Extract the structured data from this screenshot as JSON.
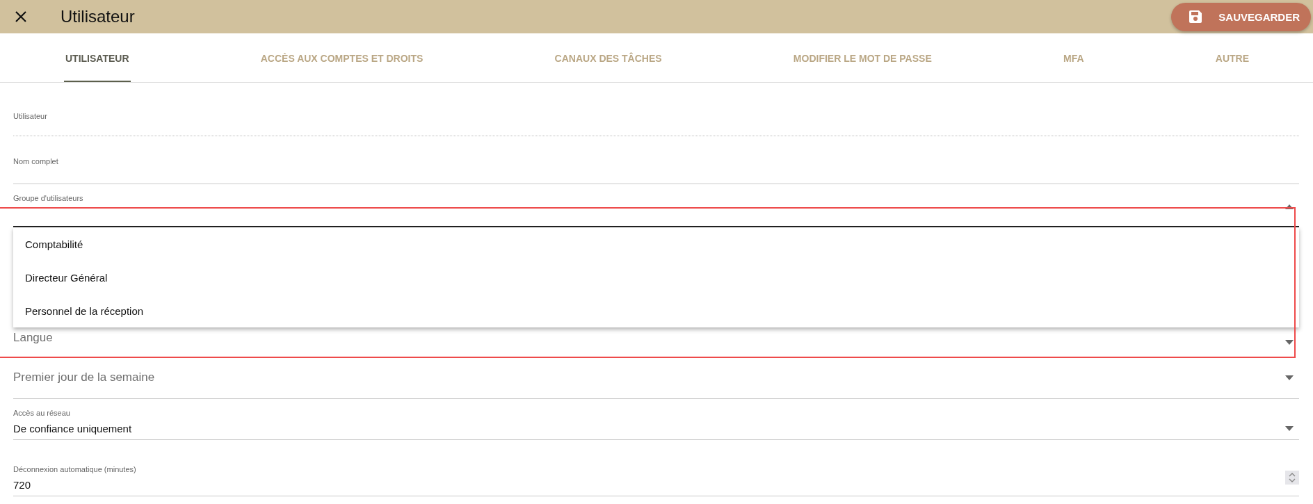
{
  "window": {
    "title": "Utilisateur"
  },
  "toolbar": {
    "save_button": "SAUVEGARDER"
  },
  "tabs": [
    {
      "label": "UTILISATEUR",
      "selected": true
    },
    {
      "label": "ACCÈS AUX COMPTES ET DROITS",
      "selected": false
    },
    {
      "label": "CANAUX DES TÂCHES",
      "selected": false
    },
    {
      "label": "MODIFIER LE MOT DE PASSE",
      "selected": false
    },
    {
      "label": "MFA",
      "selected": false
    },
    {
      "label": "AUTRE",
      "selected": false
    }
  ],
  "fields": [
    {
      "kind": "readonly",
      "label": "Utilisateur"
    },
    {
      "kind": "text",
      "label": "Nom complet"
    },
    {
      "kind": "select",
      "label": "Groupe d'utilisateurs",
      "expanded": true,
      "options": [
        {
          "label": "Comptabilité",
          "selected": false
        },
        {
          "label": "Directeur Général",
          "selected": false
        },
        {
          "label": "Personnel de la réception",
          "selected": false
        }
      ]
    },
    {
      "kind": "select",
      "placeholder": "Langue",
      "expanded": false
    },
    {
      "kind": "select",
      "placeholder": "Premier jour de la semaine",
      "expanded": false
    },
    {
      "kind": "select",
      "label": "Accès au réseau",
      "value": "De confiance uniquement",
      "expanded": false
    },
    {
      "kind": "number",
      "label": "Déconnexion automatique (minutes)",
      "value": "720"
    }
  ]
}
